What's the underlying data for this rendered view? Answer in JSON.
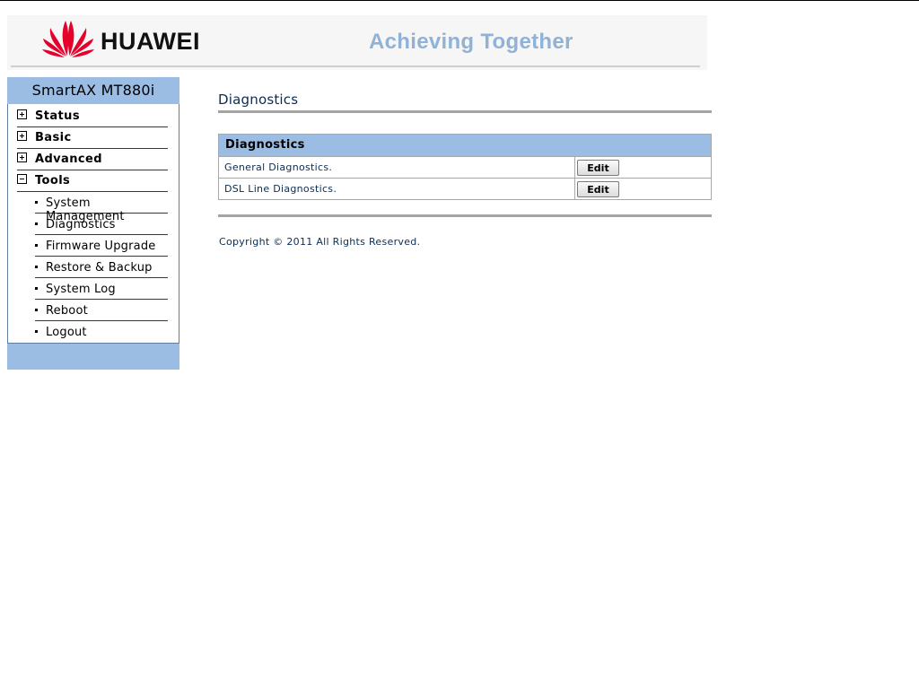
{
  "header": {
    "brand": "HUAWEI",
    "slogan": "Achieving Together",
    "brand_color": "#e4002b",
    "slogan_color": "#8fb2d6"
  },
  "sidebar": {
    "title": "SmartAX MT880i",
    "items": [
      {
        "label": "Status",
        "icon": "plus-box-icon",
        "expanded": false
      },
      {
        "label": "Basic",
        "icon": "plus-box-icon",
        "expanded": false
      },
      {
        "label": "Advanced",
        "icon": "plus-box-icon",
        "expanded": false
      },
      {
        "label": "Tools",
        "icon": "minus-box-icon",
        "expanded": true
      }
    ],
    "tools_subitems": [
      "System Management",
      "Diagnostics",
      "Firmware Upgrade",
      "Restore & Backup",
      "System Log",
      "Reboot",
      "Logout"
    ],
    "accent_color": "#9cbde3"
  },
  "main": {
    "page_title": "Diagnostics",
    "table": {
      "header": "Diagnostics",
      "rows": [
        {
          "name": "General Diagnostics.",
          "button": "Edit"
        },
        {
          "name": "DSL Line Diagnostics.",
          "button": "Edit"
        }
      ]
    },
    "copyright": "Copyright © 2011 All Rights Reserved."
  }
}
